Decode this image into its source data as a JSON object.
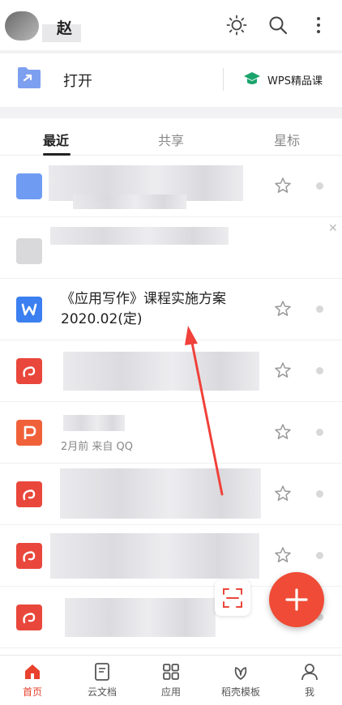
{
  "header": {
    "username": "赵",
    "icons": [
      "theme-icon",
      "search-icon",
      "more-vert-icon"
    ]
  },
  "open_row": {
    "label": "打开",
    "course_label": "WPS精品课"
  },
  "tabs": [
    "最近",
    "共享",
    "星标"
  ],
  "active_tab": "最近",
  "files": [
    {
      "type": "word",
      "title": "《应用写作》课程实施方案\n2020.02(定)",
      "meta": ""
    },
    {
      "type": "ppt",
      "title": "",
      "meta": "2月前   来自 QQ"
    }
  ],
  "colors": {
    "accent": "#ef4b36",
    "word": "#3b7ff0",
    "pdf": "#e9473b",
    "ppt": "#f0613a",
    "course": "#1aa46b"
  },
  "bottom_nav": [
    {
      "label": "首页",
      "icon": "home-icon"
    },
    {
      "label": "云文档",
      "icon": "cloud-doc-icon"
    },
    {
      "label": "应用",
      "icon": "apps-icon"
    },
    {
      "label": "稻壳模板",
      "icon": "template-icon"
    },
    {
      "label": "我",
      "icon": "profile-icon"
    }
  ]
}
